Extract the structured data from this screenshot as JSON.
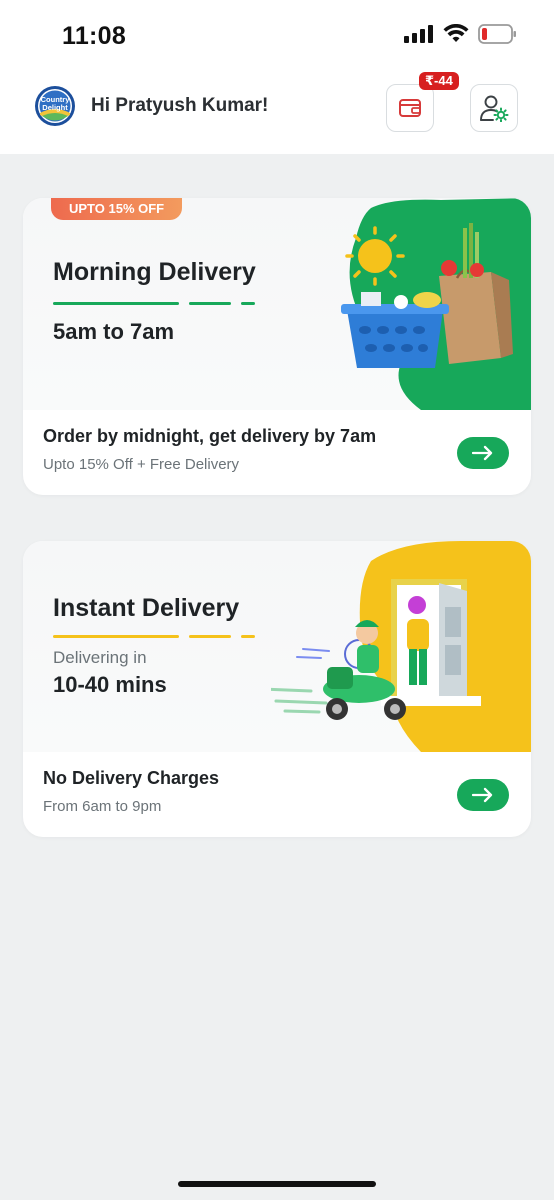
{
  "status_bar": {
    "time": "11:08",
    "icons": [
      "cellular-signal-icon",
      "wifi-icon",
      "battery-low-icon"
    ]
  },
  "header": {
    "logo_text_line1": "Country",
    "logo_text_line2": "Delight",
    "greeting": "Hi Pratyush Kumar!",
    "wallet_badge": "₹-44",
    "wallet_icon": "wallet-icon",
    "profile_icon": "profile-settings-icon"
  },
  "cards": {
    "morning": {
      "promo_tag": "UPTO 15% OFF",
      "title": "Morning Delivery",
      "time_window": "5am to 7am",
      "bottom_title": "Order by midnight, get delivery by 7am",
      "bottom_sub": "Upto 15% Off + Free Delivery",
      "accent_color": "#17a85a"
    },
    "instant": {
      "title": "Instant Delivery",
      "delivering_label": "Delivering in",
      "duration": "10-40 mins",
      "bottom_title": "No Delivery Charges",
      "bottom_sub": "From 6am to 9pm",
      "accent_color": "#f5c21b"
    }
  },
  "colors": {
    "brand_green": "#17a85a",
    "badge_red": "#d71f1f",
    "instant_yellow": "#f5c21b",
    "promo_orange": "#ee6a4e"
  }
}
